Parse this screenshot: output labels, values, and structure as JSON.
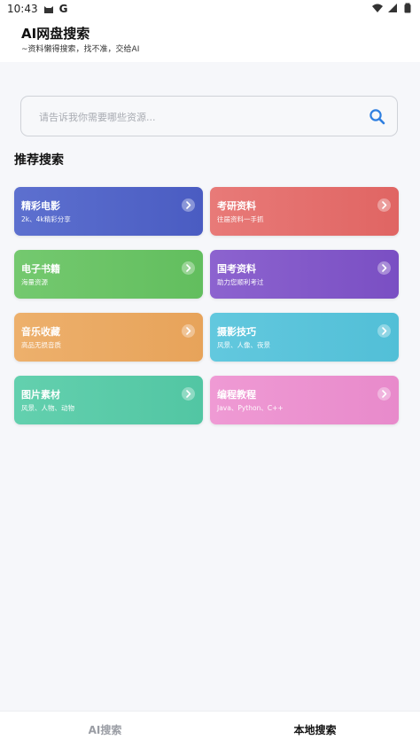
{
  "status_bar": {
    "time": "10:43",
    "g_letter": "G"
  },
  "header": {
    "title": "AI网盘搜索",
    "subtitle": "~资料懒得搜索，找不准，交给AI"
  },
  "search": {
    "placeholder": "请告诉我你需要哪些资源...",
    "value": ""
  },
  "section": {
    "title": "推荐搜索"
  },
  "cards": [
    {
      "title": "精彩电影",
      "desc": "2k、4k精彩分享",
      "from": "#5d70cf",
      "to": "#4a5cc2"
    },
    {
      "title": "考研资料",
      "desc": "往届资料一手抓",
      "from": "#e87a78",
      "to": "#e06563"
    },
    {
      "title": "电子书籍",
      "desc": "海量资源",
      "from": "#74c96f",
      "to": "#62be5e"
    },
    {
      "title": "国考资料",
      "desc": "助力您顺利考过",
      "from": "#8c63cf",
      "to": "#7a4fc3"
    },
    {
      "title": "音乐收藏",
      "desc": "高品无损音质",
      "from": "#edb06c",
      "to": "#e7a35a"
    },
    {
      "title": "摄影技巧",
      "desc": "风景、人像、夜景",
      "from": "#62c8de",
      "to": "#52bfd7"
    },
    {
      "title": "图片素材",
      "desc": "风景、人物、动物",
      "from": "#63d0ae",
      "to": "#52c6a3"
    },
    {
      "title": "编程教程",
      "desc": "Java、Python、C++",
      "from": "#ef9ad4",
      "to": "#e88acb"
    }
  ],
  "icons": {
    "search": "search-icon",
    "arrow": "chevron-right-icon"
  },
  "bottom_nav": [
    {
      "label": "AI搜索",
      "active": false
    },
    {
      "label": "本地搜索",
      "active": true
    }
  ]
}
